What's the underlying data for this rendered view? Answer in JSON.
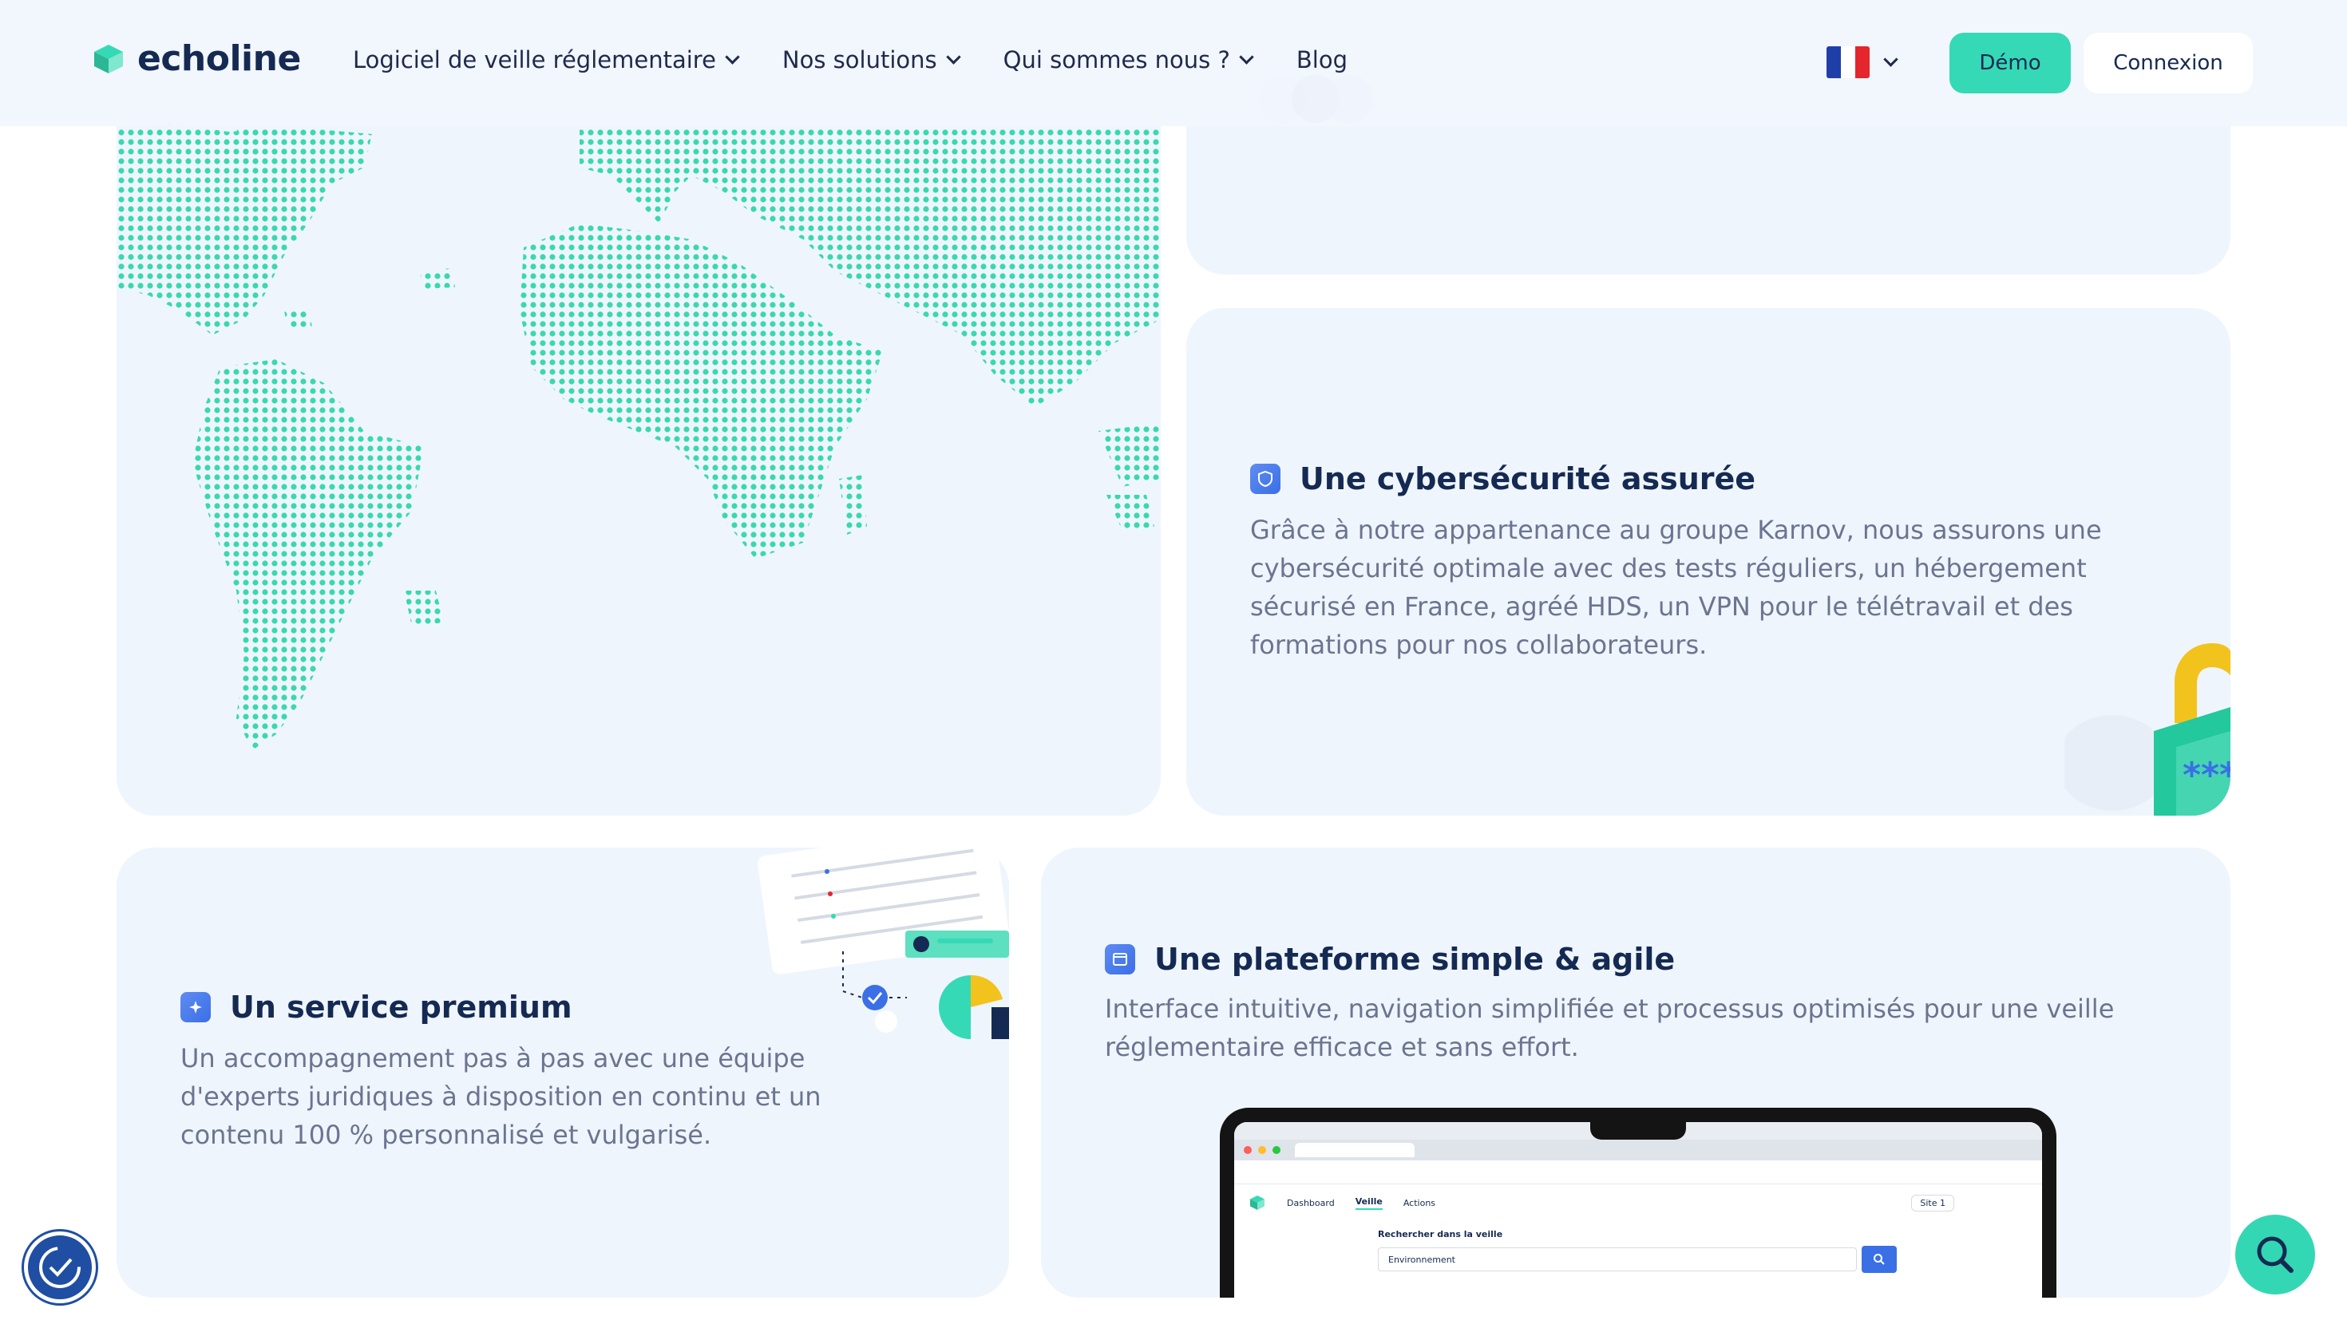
{
  "header": {
    "logo_text": "echoline",
    "nav": [
      {
        "label": "Logiciel de veille réglementaire",
        "has_dropdown": true
      },
      {
        "label": "Nos solutions",
        "has_dropdown": true
      },
      {
        "label": "Qui sommes nous ?",
        "has_dropdown": true
      },
      {
        "label": "Blog",
        "has_dropdown": false
      }
    ],
    "language_flag": "fr-flag-icon",
    "demo_label": "Démo",
    "login_label": "Connexion"
  },
  "cards": {
    "cyber": {
      "title": "Une cybersécurité assurée",
      "desc_lines": [
        "Grâce à notre appartenance au groupe Karnov, nous assurons une",
        "cybersécurité optimale avec des tests réguliers, un hébergement",
        "sécurisé en France, agréé HDS, un VPN pour le télétravail et des",
        "formations pour nos collaborateurs."
      ]
    },
    "premium": {
      "title": "Un service premium",
      "desc_lines": [
        "Un accompagnement pas à pas avec une équipe",
        "d'experts juridiques à disposition en continu et un",
        "contenu 100 % personnalisé et vulgarisé."
      ]
    },
    "platform": {
      "title": "Une plateforme simple & agile",
      "desc_lines": [
        "Interface intuitive, navigation simplifiée et processus optimisés pour une veille",
        "réglementaire efficace et sans effort."
      ],
      "laptop": {
        "tabs": [
          "Dashboard",
          "Veille",
          "Actions"
        ],
        "site_select": "Site 1",
        "search_label": "Rechercher dans la veille",
        "search_value": "Environnement"
      }
    }
  },
  "colors": {
    "accent": "#35d9b5",
    "navy": "#152a52",
    "card_bg": "#eff5fd",
    "icon_blue": "#3a6fe6"
  }
}
